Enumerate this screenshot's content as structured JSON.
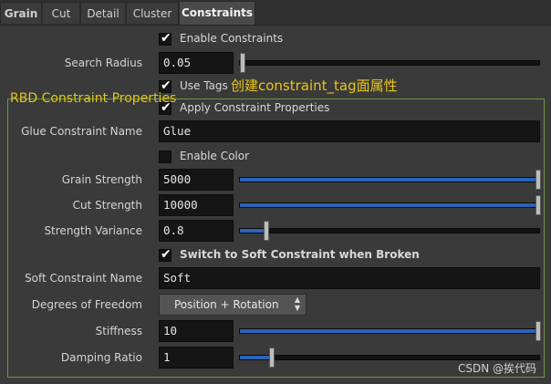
{
  "tabs": [
    "Grain",
    "Cut",
    "Detail",
    "Cluster",
    "Constraints"
  ],
  "enable_constraints": {
    "label": "Enable Constraints",
    "checked": true
  },
  "search_radius": {
    "label": "Search Radius",
    "value": "0.05",
    "slider_fraction": 0.0
  },
  "use_tags": {
    "label": "Use Tags",
    "checked": true
  },
  "annotation": "创建constraint_tag面属性",
  "group_title": "RBD Constraint Properties",
  "apply_constraint_properties": {
    "label": "Apply Constraint Properties",
    "checked": true
  },
  "glue_constraint_name": {
    "label": "Glue Constraint Name",
    "value": "Glue"
  },
  "enable_color": {
    "label": "Enable Color",
    "checked": false
  },
  "grain_strength": {
    "label": "Grain Strength",
    "value": "5000",
    "slider_fraction": 1.0
  },
  "cut_strength": {
    "label": "Cut Strength",
    "value": "10000",
    "slider_fraction": 1.0
  },
  "strength_variance": {
    "label": "Strength Variance",
    "value": "0.8",
    "slider_fraction": 0.08
  },
  "switch_soft": {
    "label": "Switch to Soft Constraint when Broken",
    "checked": true
  },
  "soft_constraint_name": {
    "label": "Soft Constraint Name",
    "value": "Soft"
  },
  "degrees_of_freedom": {
    "label": "Degrees of Freedom",
    "value": "Position + Rotation"
  },
  "stiffness": {
    "label": "Stiffness",
    "value": "10",
    "slider_fraction": 1.0
  },
  "damping_ratio": {
    "label": "Damping Ratio",
    "value": "1",
    "slider_fraction": 0.1
  },
  "watermark": "CSDN @挨代码",
  "colors": {
    "accent": "#2a64b8",
    "group_border": "#6a9a3e",
    "annotation": "#e8c41c"
  }
}
